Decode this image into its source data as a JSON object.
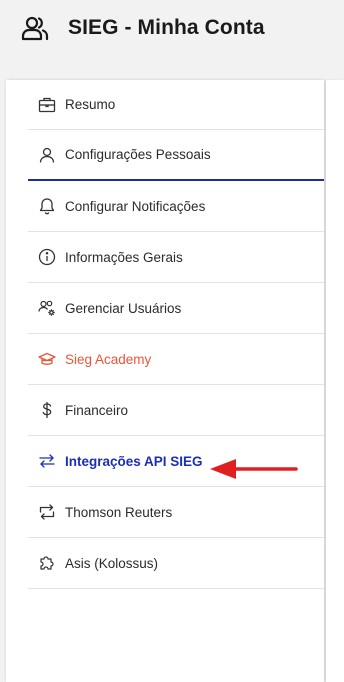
{
  "header": {
    "title": "SIEG - Minha Conta",
    "icon": "users-icon"
  },
  "menu": {
    "items": [
      {
        "label": "Resumo",
        "icon": "briefcase-icon"
      },
      {
        "label": "Configurações Pessoais",
        "icon": "user-icon",
        "active": true
      },
      {
        "label": "Configurar Notificações",
        "icon": "bell-icon"
      },
      {
        "label": "Informações Gerais",
        "icon": "info-icon"
      },
      {
        "label": "Gerenciar Usuários",
        "icon": "users-gear-icon"
      },
      {
        "label": "Sieg Academy",
        "icon": "graduation-cap-icon"
      },
      {
        "label": "Financeiro",
        "icon": "dollar-icon"
      },
      {
        "label": "Integrações API SIEG",
        "icon": "arrows-exchange-icon"
      },
      {
        "label": "Thomson Reuters",
        "icon": "repeat-icon"
      },
      {
        "label": "Asis (Kolossus)",
        "icon": "puzzle-icon"
      }
    ]
  },
  "colors": {
    "active_underline": "#1d2f8f",
    "academy": "#e8553a",
    "api_link": "#1b2fb5",
    "annotation_arrow": "#e02020",
    "header_bg": "#f2f2f2"
  },
  "annotation": {
    "icon": "red-arrow-pointer",
    "points_to": "Integrações API SIEG"
  }
}
